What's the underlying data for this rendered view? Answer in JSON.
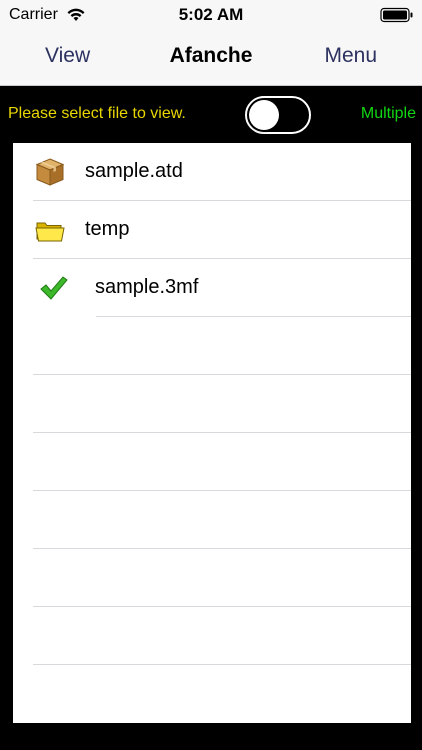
{
  "status": {
    "carrier": "Carrier",
    "time": "5:02 AM"
  },
  "nav": {
    "left": "View",
    "title": "Afanche",
    "right": "Menu"
  },
  "toolbar": {
    "prompt": "Please select file to view.",
    "multiple_label": "Multiple",
    "multiple_on": false
  },
  "files": [
    {
      "name": "sample.atd",
      "icon": "package-icon"
    },
    {
      "name": "temp",
      "icon": "folder-icon"
    },
    {
      "name": "sample.3mf",
      "icon": "checkmark-icon"
    }
  ],
  "colors": {
    "prompt": "#e8d700",
    "multiple": "#12d612",
    "nav_button": "#2d3160"
  }
}
